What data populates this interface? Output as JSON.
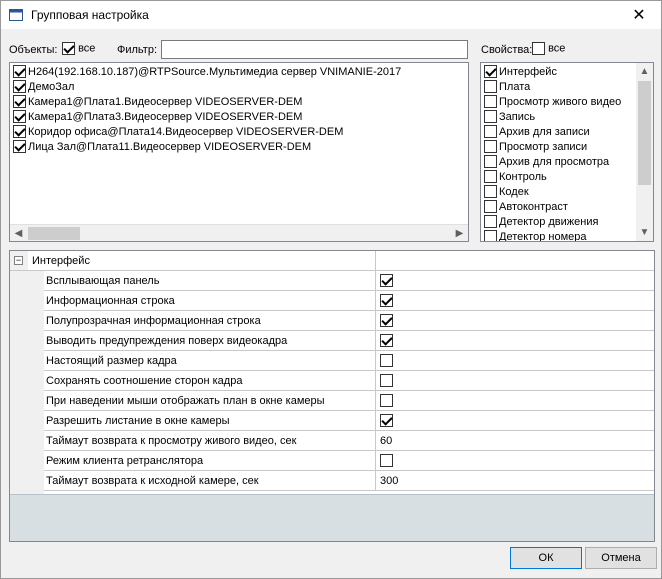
{
  "window": {
    "title": "Групповая настройка",
    "close_glyph": "✕"
  },
  "toolbar": {
    "objects_label": "Объекты:",
    "objects_all_label": "все",
    "objects_all_checked": true,
    "filter_label": "Фильтр:",
    "filter_value": "",
    "properties_label": "Свойства:",
    "properties_all_label": "все",
    "properties_all_checked": false
  },
  "objects": [
    {
      "label": "H264(192.168.10.187)@RTPSource.Мультимедиа сервер VNIMANIE-2017",
      "checked": true
    },
    {
      "label": "ДемоЗал",
      "checked": true
    },
    {
      "label": "Камера1@Плата1.Видеосервер VIDEOSERVER-DEM",
      "checked": true
    },
    {
      "label": "Камера1@Плата3.Видеосервер VIDEOSERVER-DEM",
      "checked": true
    },
    {
      "label": "Коридор офиса@Плата14.Видеосервер VIDEOSERVER-DEM",
      "checked": true
    },
    {
      "label": "Лица Зал@Плата11.Видеосервер VIDEOSERVER-DEM",
      "checked": true
    }
  ],
  "properties": [
    {
      "label": "Интерфейс",
      "checked": true
    },
    {
      "label": "Плата",
      "checked": false
    },
    {
      "label": "Просмотр живого видео",
      "checked": false
    },
    {
      "label": "Запись",
      "checked": false
    },
    {
      "label": "Архив для записи",
      "checked": false
    },
    {
      "label": "Просмотр записи",
      "checked": false
    },
    {
      "label": "Архив для просмотра",
      "checked": false
    },
    {
      "label": "Контроль",
      "checked": false
    },
    {
      "label": "Кодек",
      "checked": false
    },
    {
      "label": "Автоконтраст",
      "checked": false
    },
    {
      "label": "Детектор движения",
      "checked": false
    },
    {
      "label": "Детектор номера",
      "checked": false
    }
  ],
  "grid": {
    "group_label": "Интерфейс",
    "collapse_glyph": "−",
    "rows": [
      {
        "name": "Всплывающая панель",
        "type": "checkbox",
        "checked": true
      },
      {
        "name": "Информационная строка",
        "type": "checkbox",
        "checked": true
      },
      {
        "name": "Полупрозрачная информационная строка",
        "type": "checkbox",
        "checked": true
      },
      {
        "name": "Выводить предупреждения поверх видеокадра",
        "type": "checkbox",
        "checked": true
      },
      {
        "name": "Настоящий размер кадра",
        "type": "checkbox",
        "checked": false
      },
      {
        "name": "Сохранять соотношение сторон кадра",
        "type": "checkbox",
        "checked": false
      },
      {
        "name": "При наведении мыши отображать план в окне камеры",
        "type": "checkbox",
        "checked": false
      },
      {
        "name": "Разрешить листание в окне камеры",
        "type": "checkbox",
        "checked": true
      },
      {
        "name": "Таймаут возврата к просмотру живого видео, сек",
        "type": "text",
        "value": "60"
      },
      {
        "name": "Режим клиента ретранслятора",
        "type": "checkbox",
        "checked": false
      },
      {
        "name": "Таймаут возврата к исходной камере, сек",
        "type": "text",
        "value": "300"
      }
    ]
  },
  "buttons": {
    "ok": "ОК",
    "cancel": "Отмена"
  },
  "colors": {
    "grid_description_bg": "#d7dfe3",
    "accent": "#0078d7"
  }
}
